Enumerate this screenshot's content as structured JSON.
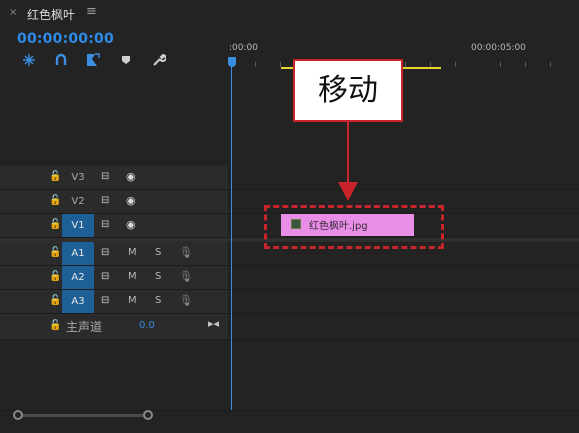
{
  "tab": {
    "close": "×",
    "title": "红色枫叶",
    "menu": "≡"
  },
  "header": {
    "timecode": "00:00:00:00",
    "tools": [
      "snap-icon",
      "linked-selection-icon",
      "add-marker-icon",
      "marker-icon",
      "wrench-icon"
    ]
  },
  "ruler": {
    "t0": ":00:00",
    "t5": "00:00:05:00"
  },
  "tracks": [
    {
      "name": "V3",
      "type": "video",
      "active": false,
      "lock": "🔓",
      "film": "⊟",
      "eye": "◉"
    },
    {
      "name": "V2",
      "type": "video",
      "active": false,
      "lock": "🔓",
      "film": "⊟",
      "eye": "◉"
    },
    {
      "name": "V1",
      "type": "video",
      "active": true,
      "lock": "🔓",
      "film": "⊟",
      "eye": "◉"
    },
    {
      "name": "A1",
      "type": "audio",
      "active": true,
      "lock": "🔓",
      "film": "⊟",
      "m": "M",
      "s": "S",
      "mic": "🎙"
    },
    {
      "name": "A2",
      "type": "audio",
      "active": true,
      "lock": "🔓",
      "film": "⊟",
      "m": "M",
      "s": "S",
      "mic": "🎙"
    },
    {
      "name": "A3",
      "type": "audio",
      "active": true,
      "lock": "🔓",
      "film": "⊟",
      "m": "M",
      "s": "S",
      "mic": "🎙"
    }
  ],
  "master": {
    "lock": "🔓",
    "label": "主声道",
    "volume": "0.0",
    "nav": "▸◂"
  },
  "clip": {
    "label": "红色枫叶.jpg",
    "color": "#e88ee6"
  },
  "annotation": {
    "callout_text": "移动",
    "color": "#c9232b"
  },
  "colors": {
    "accent": "#2d8ceb",
    "workarea": "#e8d32a",
    "track_active": "#1d5f96"
  }
}
